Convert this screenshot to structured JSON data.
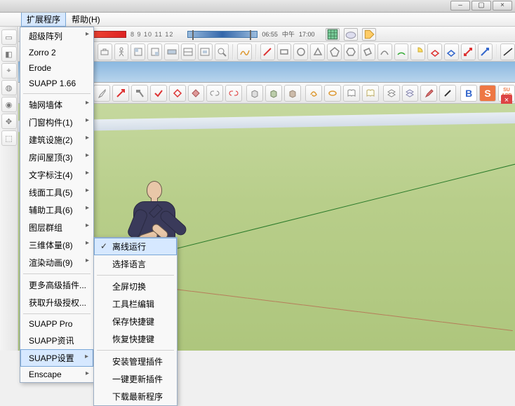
{
  "menubar": {
    "extensions": "扩展程序",
    "help": "帮助(H)"
  },
  "timestrip": {
    "numbers": "8 9 10 11 12",
    "t1": "06:55",
    "mid": "中午",
    "t2": "17:00"
  },
  "dropdown": {
    "items": [
      "超级阵列",
      "Zorro 2",
      "Erode",
      "SUAPP 1.66",
      "轴网墙体",
      "门窗构件(1)",
      "建筑设施(2)",
      "房间屋顶(3)",
      "文字标注(4)",
      "线面工具(5)",
      "辅助工具(6)",
      "图层群组",
      "三维体量(8)",
      "渲染动画(9)",
      "更多高级插件...",
      "获取升级授权...",
      "SUAPP Pro",
      "SUAPP资讯",
      "SUAPP设置",
      "Enscape"
    ]
  },
  "submenu": {
    "items": [
      "离线运行",
      "选择语言",
      "全屏切换",
      "工具栏编辑",
      "保存快捷键",
      "恢复快捷键",
      "安装管理插件",
      "一键更新插件",
      "下载最新程序"
    ]
  },
  "badges": {
    "b1": "B",
    "b2": "S",
    "su": "SU\nAPP"
  },
  "closebtn": "×"
}
